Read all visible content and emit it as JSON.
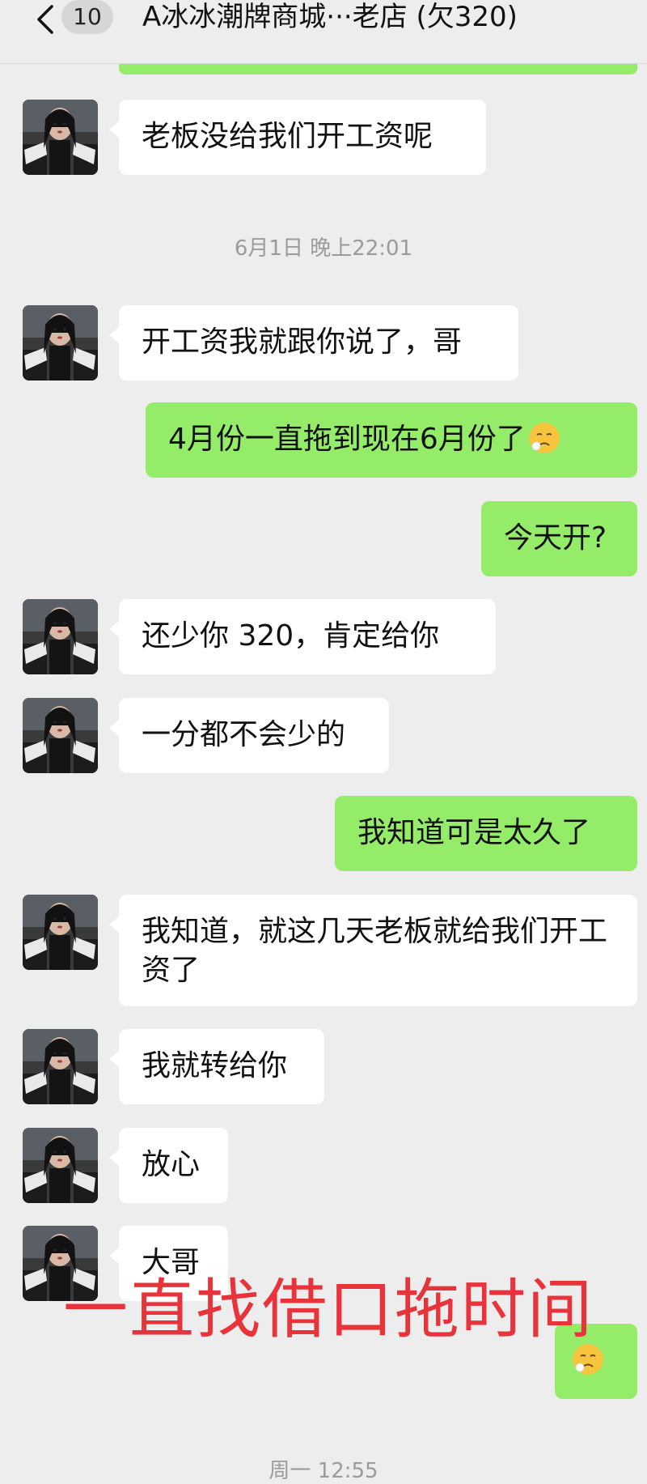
{
  "header": {
    "unread_count": "10",
    "title": "A冰冰潮牌商城···老店 (欠320)"
  },
  "timestamps": {
    "t1": "6月1日 晚上22:01",
    "t2": "周一 12:55"
  },
  "messages": {
    "m1": "老板没给我们开工资呢",
    "m2": "开工资我就跟你说了，哥",
    "m3": "4月份一直拖到现在6月份了",
    "m4": "今天开?",
    "m5": "还少你 320，肯定给你",
    "m6": "一分都不会少的",
    "m7": "我知道可是太久了",
    "m8": "我知道，就这几天老板就给我们开工资了",
    "m9": "我就转给你",
    "m10": "放心",
    "m11": "大哥"
  },
  "overlay": {
    "caption": "一直找借口拖时间"
  },
  "colors": {
    "background": "#ededed",
    "sent_bubble": "#95ec69",
    "received_bubble": "#ffffff",
    "caption_red": "#e8333a",
    "timestamp_gray": "#9b9b9b"
  },
  "icons": {
    "back": "chevron-left-icon",
    "emoji": "sad-face-emoji-icon"
  }
}
